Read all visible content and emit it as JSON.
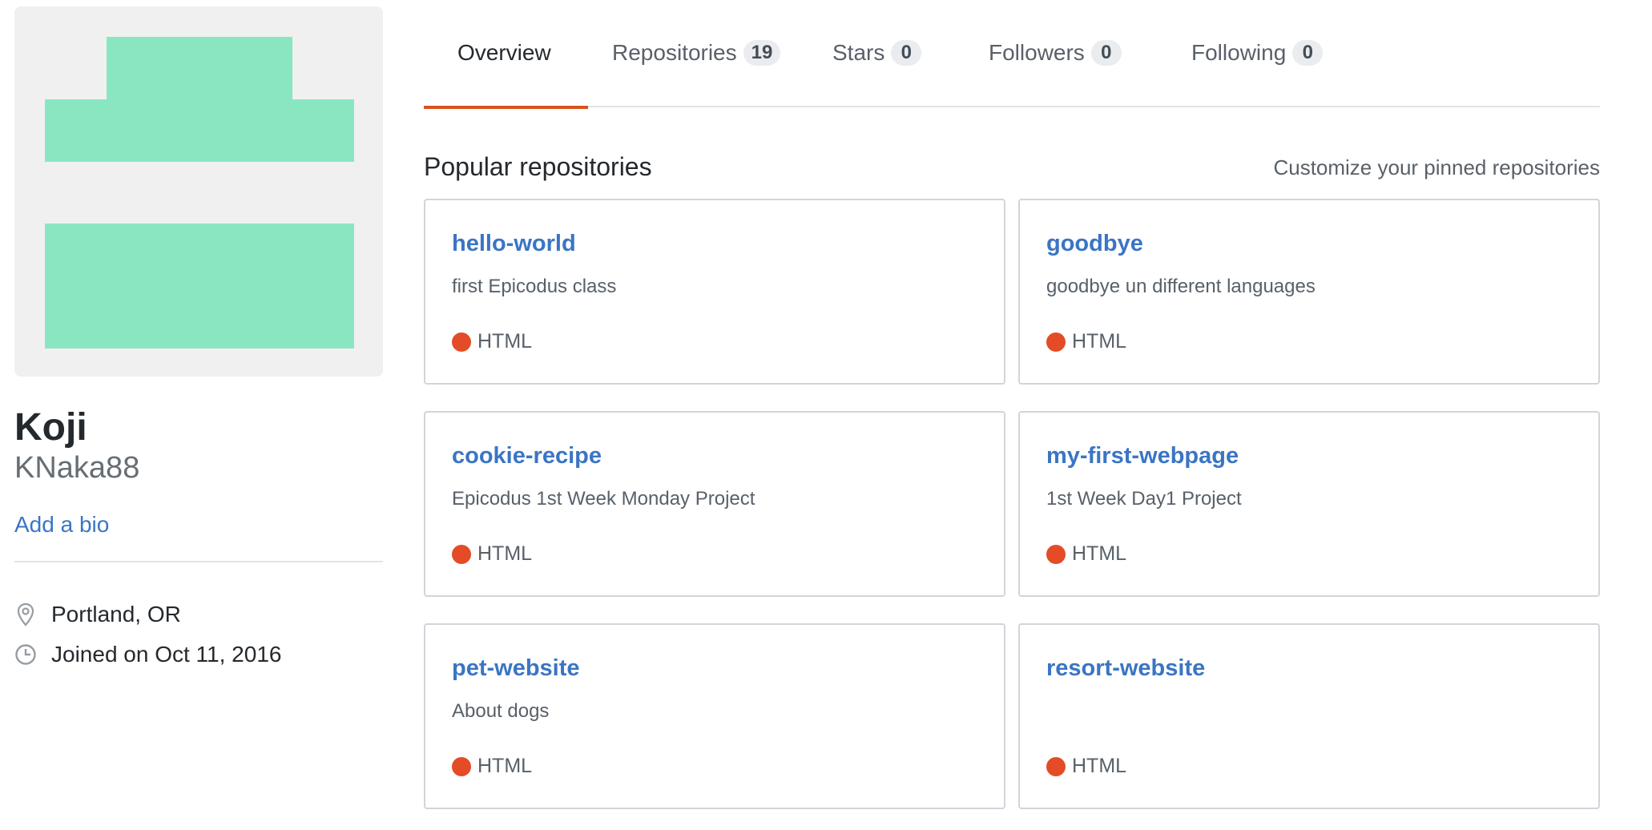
{
  "profile": {
    "fullname": "Koji",
    "username": "KNaka88",
    "add_bio_label": "Add a bio",
    "location": "Portland, OR",
    "joined": "Joined on Oct 11, 2016",
    "avatar_color": "#8ae6c1",
    "avatar_bg": "#f0f0f0"
  },
  "tabs": [
    {
      "label": "Overview",
      "count": null,
      "active": true
    },
    {
      "label": "Repositories",
      "count": "19",
      "active": false
    },
    {
      "label": "Stars",
      "count": "0",
      "active": false
    },
    {
      "label": "Followers",
      "count": "0",
      "active": false
    },
    {
      "label": "Following",
      "count": "0",
      "active": false
    }
  ],
  "section": {
    "title": "Popular repositories",
    "customize_label": "Customize your pinned repositories"
  },
  "repos": [
    {
      "name": "hello-world",
      "description": "first Epicodus class",
      "language": "HTML"
    },
    {
      "name": "goodbye",
      "description": "goodbye un different languages",
      "language": "HTML"
    },
    {
      "name": "cookie-recipe",
      "description": "Epicodus 1st Week Monday Project",
      "language": "HTML"
    },
    {
      "name": "my-first-webpage",
      "description": "1st Week Day1 Project",
      "language": "HTML"
    },
    {
      "name": "pet-website",
      "description": "About dogs",
      "language": "HTML"
    },
    {
      "name": "resort-website",
      "description": "",
      "language": "HTML"
    }
  ],
  "colors": {
    "link": "#3a75c4",
    "active_tab_underline": "#d9531e",
    "html_language": "#e34c26"
  },
  "icons": {
    "location": "location-pin-icon",
    "joined": "clock-icon"
  }
}
